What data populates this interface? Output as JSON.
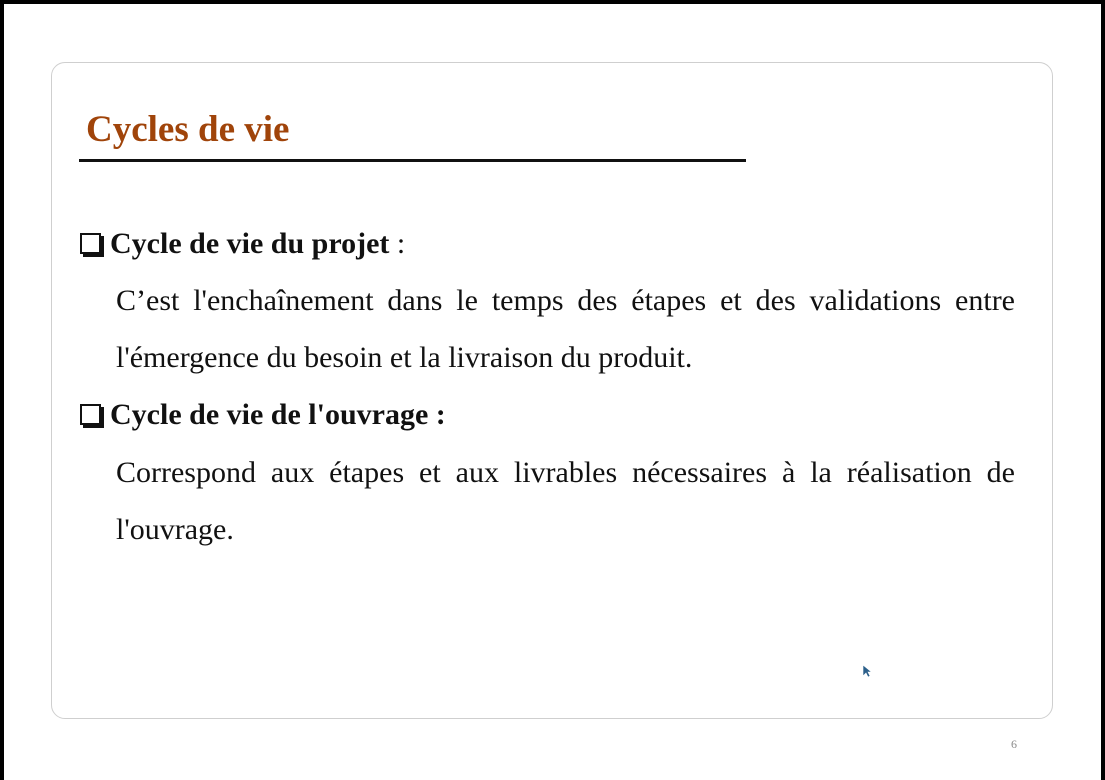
{
  "slide": {
    "title": "Cycles de vie",
    "sections": [
      {
        "heading": "Cycle de vie du projet",
        "separator": " :",
        "text": "C’est l'enchaînement dans le temps des étapes et des validations entre l'émergence du besoin et la livraison du produit."
      },
      {
        "heading": "Cycle de vie de l'ouvrage :",
        "separator": "",
        "text": "Correspond aux étapes et aux livrables nécessaires à la réalisation de l'ouvrage."
      }
    ],
    "page_number": "6"
  },
  "icons": {
    "bullet": "checkbox-outline-icon",
    "cursor": "mouse-pointer-icon"
  },
  "colors": {
    "title": "#a0440a",
    "text": "#111111",
    "frame": "#000000",
    "page_number": "#8a8a8a"
  }
}
